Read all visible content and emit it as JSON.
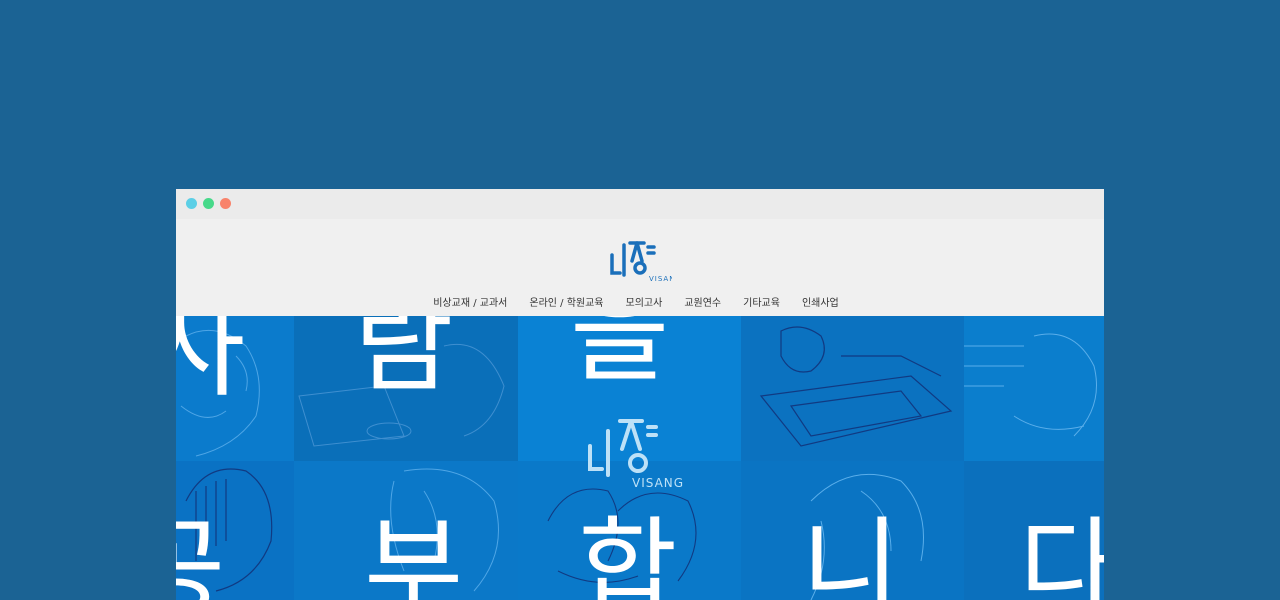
{
  "window": {
    "controls": [
      "cyan-dot",
      "green-dot",
      "orange-dot"
    ]
  },
  "site": {
    "logo_text": "VISANG",
    "nav": [
      "비상교재 / 교과서",
      "온라인 / 학원교육",
      "모의고사",
      "교원연수",
      "기타교육",
      "인쇄사업"
    ]
  },
  "hero": {
    "background_color": "#0a76c6",
    "row1_chars": [
      "사",
      "람",
      "을"
    ],
    "row2_chars": [
      "공",
      "부",
      "합",
      "니",
      "다"
    ],
    "watermark_text": "VISANG"
  },
  "colors": {
    "page_bg": "#1b6394",
    "header_bg": "#f0f0f0",
    "logo_blue": "#1a6fba"
  }
}
